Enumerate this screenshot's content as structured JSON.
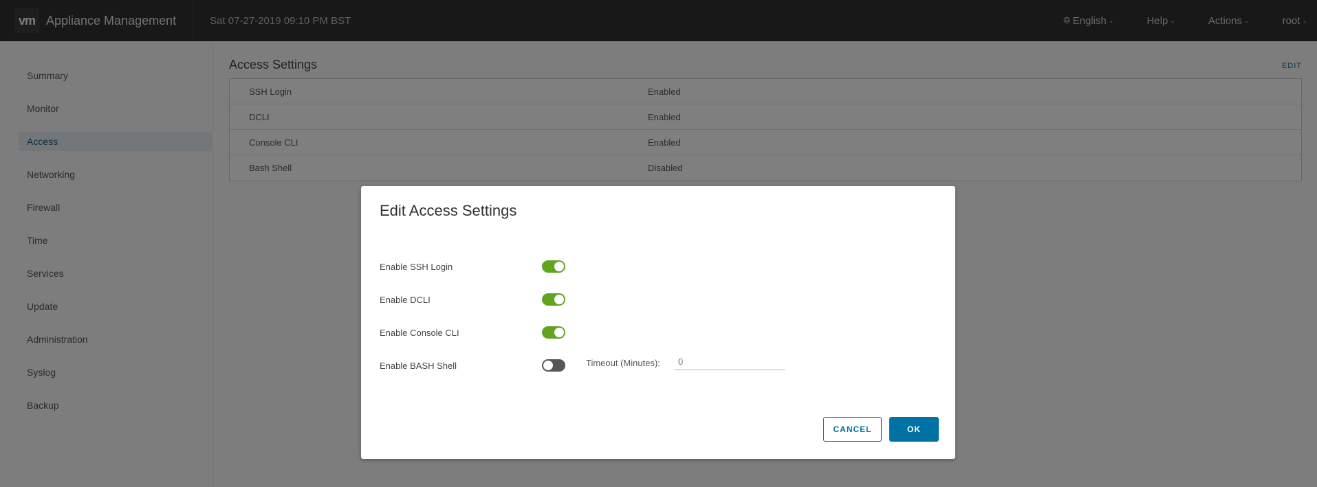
{
  "header": {
    "logo": "vm",
    "app_title": "Appliance Management",
    "datetime": "Sat 07-27-2019 09:10 PM BST",
    "language": "English",
    "help": "Help",
    "actions": "Actions",
    "user": "root"
  },
  "sidebar": {
    "items": [
      {
        "label": "Summary",
        "active": false
      },
      {
        "label": "Monitor",
        "active": false
      },
      {
        "label": "Access",
        "active": true
      },
      {
        "label": "Networking",
        "active": false
      },
      {
        "label": "Firewall",
        "active": false
      },
      {
        "label": "Time",
        "active": false
      },
      {
        "label": "Services",
        "active": false
      },
      {
        "label": "Update",
        "active": false
      },
      {
        "label": "Administration",
        "active": false
      },
      {
        "label": "Syslog",
        "active": false
      },
      {
        "label": "Backup",
        "active": false
      }
    ]
  },
  "main": {
    "title": "Access Settings",
    "edit_label": "EDIT",
    "rows": [
      {
        "key": "SSH Login",
        "value": "Enabled"
      },
      {
        "key": "DCLI",
        "value": "Enabled"
      },
      {
        "key": "Console CLI",
        "value": "Enabled"
      },
      {
        "key": "Bash Shell",
        "value": "Disabled"
      }
    ]
  },
  "modal": {
    "title": "Edit Access Settings",
    "options": [
      {
        "label": "Enable SSH Login",
        "enabled": true
      },
      {
        "label": "Enable DCLI",
        "enabled": true
      },
      {
        "label": "Enable Console CLI",
        "enabled": true
      },
      {
        "label": "Enable BASH Shell",
        "enabled": false
      }
    ],
    "timeout_label": "Timeout (Minutes):",
    "timeout_value": "0",
    "cancel_label": "CANCEL",
    "ok_label": "OK"
  },
  "colors": {
    "header_bg": "#313131",
    "toggle_on": "#62a420",
    "toggle_off": "#575757",
    "primary": "#0072a3"
  }
}
